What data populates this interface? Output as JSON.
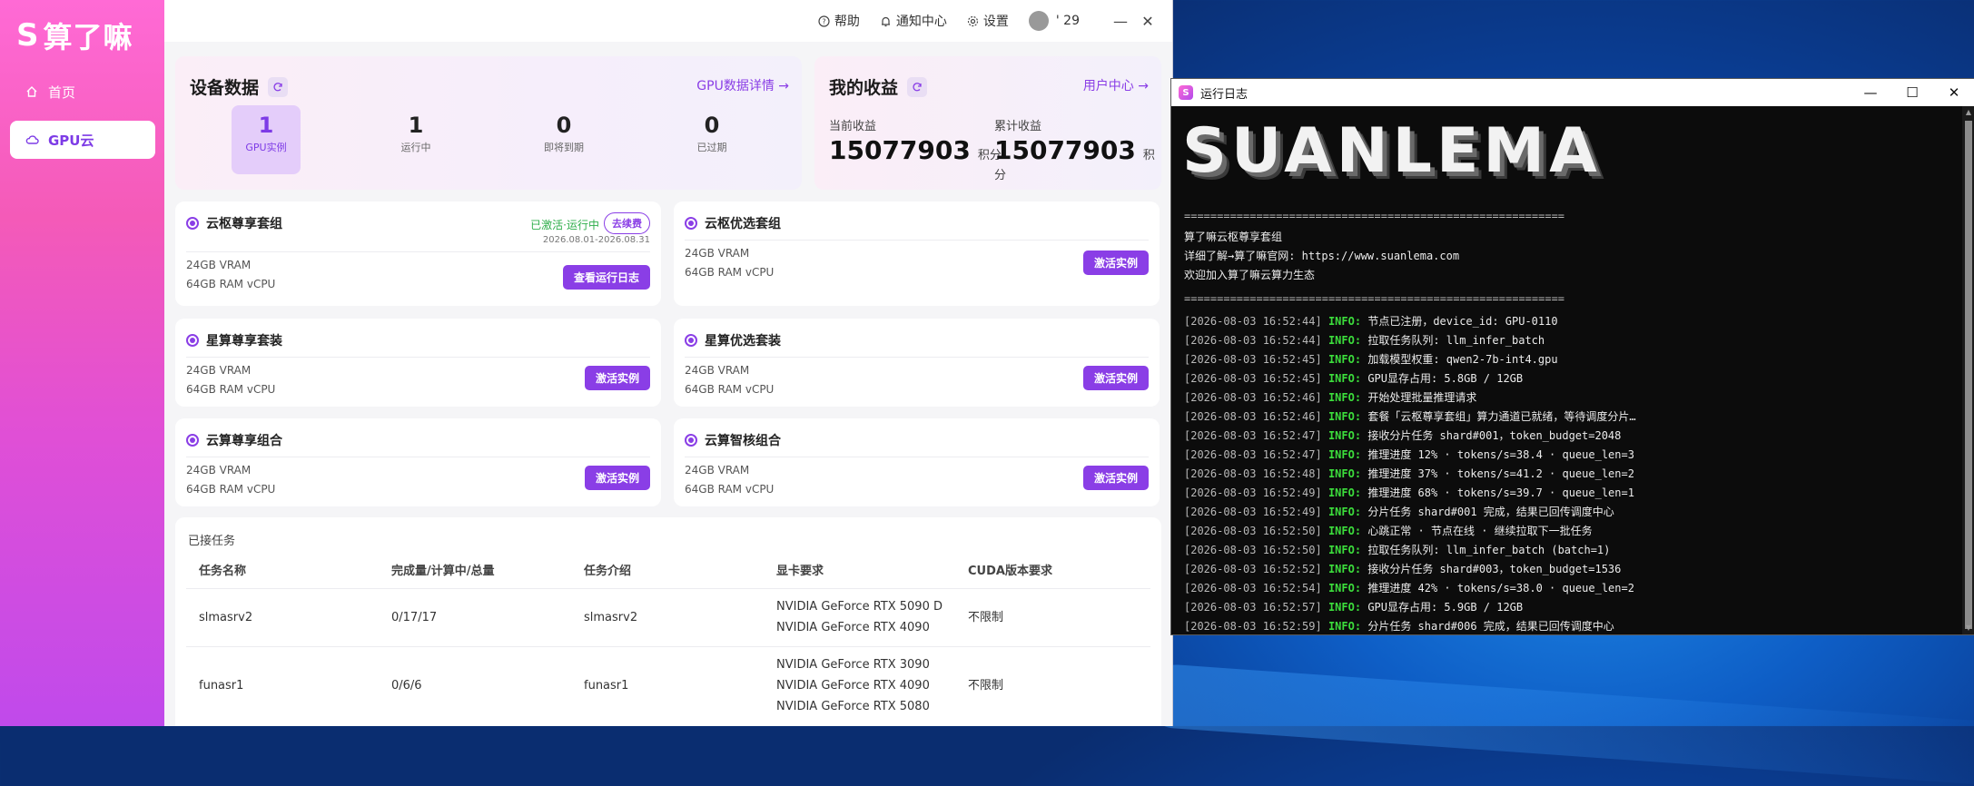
{
  "app": {
    "logo_text": "算了嘛",
    "logo_mark": "S",
    "nav": [
      {
        "label": "首页",
        "icon": "home-icon"
      },
      {
        "label": "GPU云",
        "icon": "cloud-icon"
      }
    ],
    "topbar": {
      "help": "帮助",
      "notifications": "通知中心",
      "settings": "设置",
      "user_suffix": "' 29"
    },
    "device_panel": {
      "title": "设备数据",
      "link": "GPU数据详情 →",
      "stats": [
        {
          "value": "1",
          "label": "GPU实例"
        },
        {
          "value": "1",
          "label": "运行中"
        },
        {
          "value": "0",
          "label": "即将到期"
        },
        {
          "value": "0",
          "label": "已过期"
        }
      ]
    },
    "earnings_panel": {
      "title": "我的收益",
      "link": "用户中心 →",
      "current_label": "当前收益",
      "current_value": "15077903",
      "total_label": "累计收益",
      "total_value": "15077903",
      "unit": "积分"
    },
    "cards": [
      {
        "title": "云枢尊享套组",
        "vram": "24GB VRAM",
        "ram": "64GB RAM vCPU",
        "status": "已激活·运行中",
        "renew": "去续费",
        "dates": "2026.08.01-2026.08.31",
        "button": "查看运行日志"
      },
      {
        "title": "云枢优选套组",
        "vram": "24GB VRAM",
        "ram": "64GB RAM vCPU",
        "button": "激活实例"
      },
      {
        "title": "星算尊享套装",
        "vram": "24GB VRAM",
        "ram": "64GB RAM vCPU",
        "button": "激活实例"
      },
      {
        "title": "星算优选套装",
        "vram": "24GB VRAM",
        "ram": "64GB RAM vCPU",
        "button": "激活实例"
      },
      {
        "title": "云算尊享组合",
        "vram": "24GB VRAM",
        "ram": "64GB RAM vCPU",
        "button": "激活实例"
      },
      {
        "title": "云算智核组合",
        "vram": "24GB VRAM",
        "ram": "64GB RAM vCPU",
        "button": "激活实例"
      }
    ],
    "tasks": {
      "title": "已接任务",
      "headers": [
        "任务名称",
        "完成量/计算中/总量",
        "任务介绍",
        "显卡要求",
        "CUDA版本要求"
      ],
      "rows": [
        {
          "name": "slmasrv2",
          "progress": "0/17/17",
          "intro": "slmasrv2",
          "gpus": [
            "NVIDIA GeForce RTX 5090 D",
            "NVIDIA GeForce RTX 4090"
          ],
          "cuda": "不限制"
        },
        {
          "name": "funasr1",
          "progress": "0/6/6",
          "intro": "funasr1",
          "gpus": [
            "NVIDIA GeForce RTX 3090",
            "NVIDIA GeForce RTX 4090",
            "NVIDIA GeForce RTX 5080"
          ],
          "cuda": "不限制"
        }
      ]
    }
  },
  "terminal": {
    "title": "运行日志",
    "banner": "SUANLEMA",
    "rule": "==========================================================",
    "intro": [
      "算了嘛云枢尊享套组",
      "详细了解→算了嘛官网: https://www.suanlema.com",
      "欢迎加入算了嘛云算力生态"
    ],
    "level": "INFO:",
    "logs": [
      {
        "ts": "[2026-08-03 16:52:44]",
        "msg": "节点已注册，device_id: GPU-0110"
      },
      {
        "ts": "[2026-08-03 16:52:44]",
        "msg": "拉取任务队列: llm_infer_batch"
      },
      {
        "ts": "[2026-08-03 16:52:45]",
        "msg": "加载模型权重: qwen2-7b-int4.gpu"
      },
      {
        "ts": "[2026-08-03 16:52:45]",
        "msg": "GPU显存占用: 5.8GB / 12GB"
      },
      {
        "ts": "[2026-08-03 16:52:46]",
        "msg": "开始处理批量推理请求"
      },
      {
        "ts": "[2026-08-03 16:52:46]",
        "msg": "套餐「云枢尊享套组」算力通道已就绪，等待调度分片…"
      },
      {
        "ts": "[2026-08-03 16:52:47]",
        "msg": "接收分片任务 shard#001，token_budget=2048"
      },
      {
        "ts": "[2026-08-03 16:52:47]",
        "msg": "推理进度 12% · tokens/s=38.4 · queue_len=3"
      },
      {
        "ts": "[2026-08-03 16:52:48]",
        "msg": "推理进度 37% · tokens/s=41.2 · queue_len=2"
      },
      {
        "ts": "[2026-08-03 16:52:49]",
        "msg": "推理进度 68% · tokens/s=39.7 · queue_len=1"
      },
      {
        "ts": "[2026-08-03 16:52:49]",
        "msg": "分片任务 shard#001 完成，结果已回传调度中心"
      },
      {
        "ts": "[2026-08-03 16:52:50]",
        "msg": "心跳正常 · 节点在线 · 继续拉取下一批任务"
      },
      {
        "ts": "[2026-08-03 16:52:50]",
        "msg": "拉取任务队列: llm_infer_batch (batch=1)"
      },
      {
        "ts": "[2026-08-03 16:52:52]",
        "msg": "接收分片任务 shard#003，token_budget=1536"
      },
      {
        "ts": "[2026-08-03 16:52:54]",
        "msg": "推理进度 42% · tokens/s=38.0 · queue_len=2"
      },
      {
        "ts": "[2026-08-03 16:52:57]",
        "msg": "GPU显存占用: 5.9GB / 12GB"
      },
      {
        "ts": "[2026-08-03 16:52:59]",
        "msg": "分片任务 shard#006 完成，结果已回传调度中心"
      }
    ]
  },
  "colors": {
    "accent": "#8a3ee6",
    "sidebar_top": "#ff6ad5",
    "sidebar_bottom": "#c04aeb",
    "log_info": "#3cdd3c",
    "desktop": "#0e5ec6"
  }
}
